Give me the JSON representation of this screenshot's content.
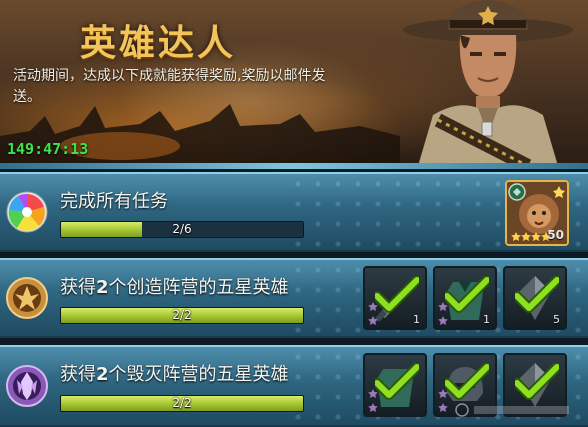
{
  "banner": {
    "title": "英雄达人",
    "description": "活动期间，达成以下成就能获得奖励,奖励以邮件发送。",
    "timer": "149:47:13"
  },
  "tasks": [
    {
      "label": "完成所有任务",
      "progress_text": "2/6",
      "progress": 0.333,
      "icon": "rainbow-orb-icon",
      "rewards": [
        {
          "type": "hero-card",
          "icon": "lion-hero-icon",
          "count": "50",
          "stars": 4
        }
      ]
    },
    {
      "label_prefix": "获得",
      "label_num": "2",
      "label_suffix": "个创造阵营的五星英雄",
      "progress_text": "2/2",
      "progress": 1.0,
      "icon": "creation-faction-icon",
      "rewards": [
        {
          "icon": "weapon-icon",
          "count": "1",
          "completed": true
        },
        {
          "icon": "armor-icon",
          "count": "1",
          "completed": true
        },
        {
          "icon": "crystal-icon",
          "count": "5",
          "completed": true
        }
      ]
    },
    {
      "label_prefix": "获得",
      "label_num": "2",
      "label_suffix": "个毁灭阵营的五星英雄",
      "progress_text": "2/2",
      "progress": 1.0,
      "icon": "destruction-faction-icon",
      "rewards": [
        {
          "icon": "armor-icon",
          "completed": true
        },
        {
          "icon": "helmet-icon",
          "completed": true
        },
        {
          "icon": "crystal-icon",
          "completed": true
        }
      ]
    }
  ],
  "colors": {
    "timer": "#3fe34a",
    "title": "#f2c45a",
    "progress_fill": "#a8c833",
    "check": "#8fe020"
  }
}
